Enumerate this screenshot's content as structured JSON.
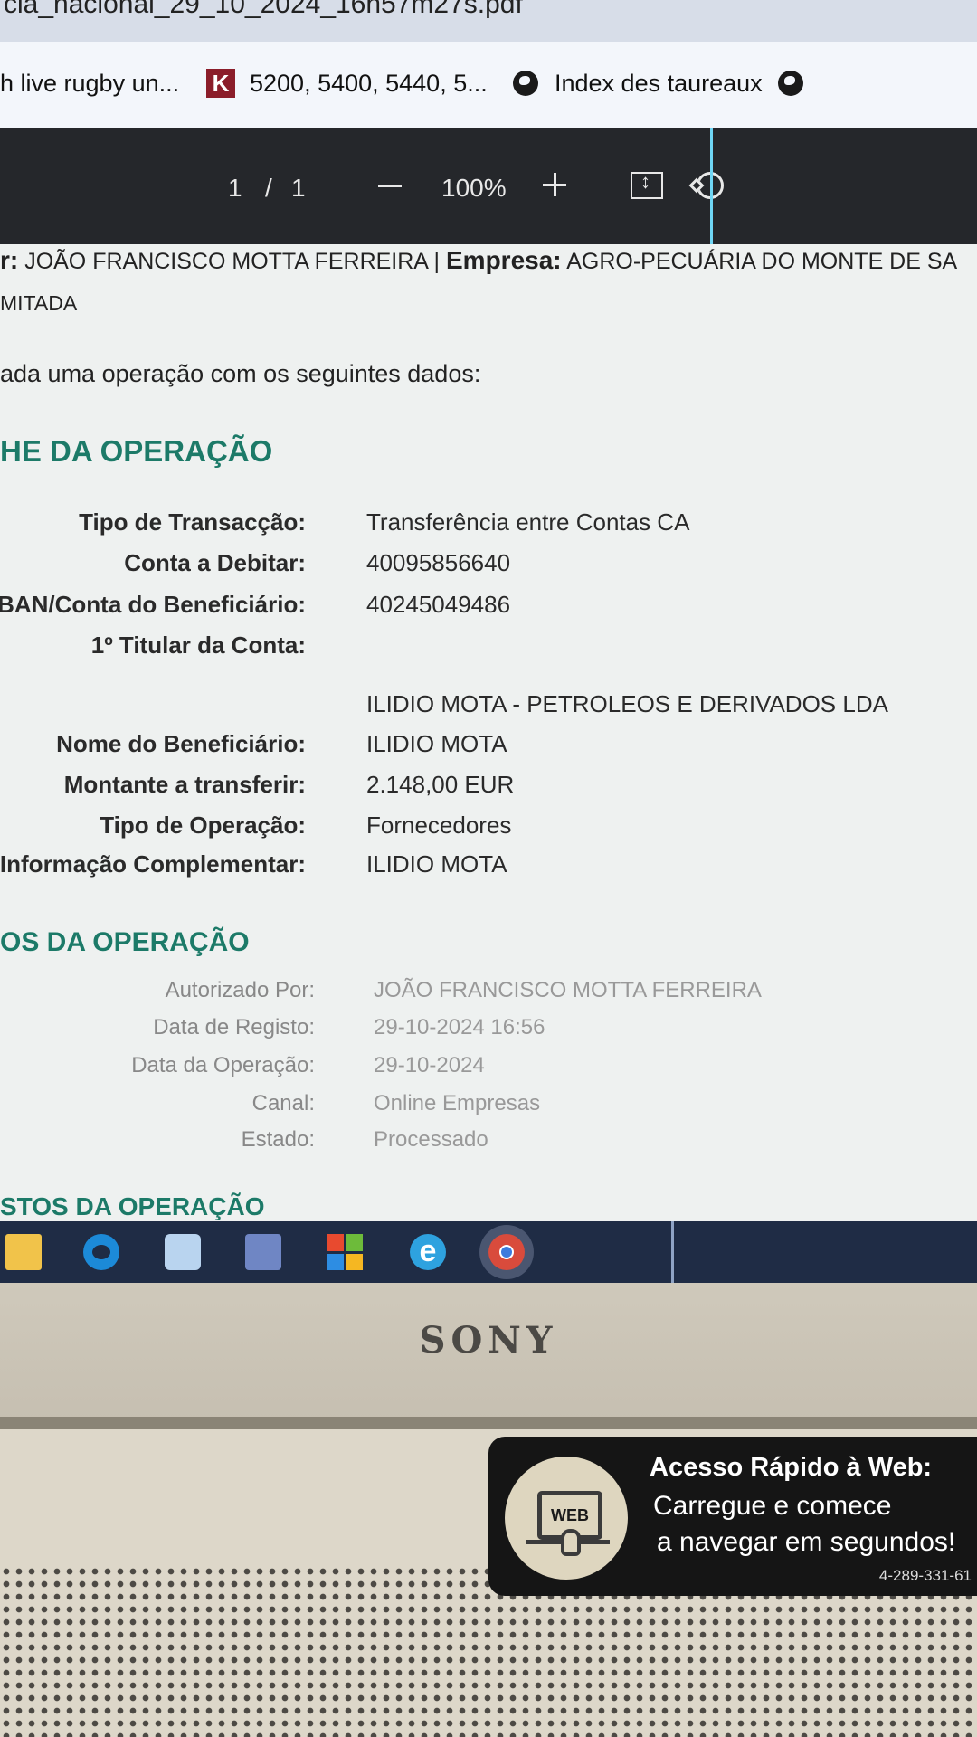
{
  "window": {
    "title_fragment": "cia_nacional_29_10_2024_16h57m27s.pdf"
  },
  "bookmarks": [
    {
      "label": "h live rugby un...",
      "icon": "none"
    },
    {
      "label": "5200, 5400, 5440, 5...",
      "icon": "k-icon"
    },
    {
      "label": "Index des taureaux",
      "icon": "globe-icon"
    },
    {
      "label": "",
      "icon": "globe-icon"
    }
  ],
  "pdf_toolbar": {
    "page_current": "1",
    "page_separator": "/",
    "page_total": "1",
    "zoom_out": "−",
    "zoom": "100%",
    "zoom_in": "+"
  },
  "document": {
    "header_label1": "r:",
    "header_value1": "JOÃO FRANCISCO MOTTA FERREIRA |",
    "header_label2": "Empresa:",
    "header_value2": "AGRO-PECUÁRIA DO MONTE DE SA",
    "header_line2": "MITADA",
    "intro": "ada uma operação com os seguintes dados:",
    "section1_title": "HE DA OPERAÇÃO",
    "details": [
      {
        "label": "Tipo de Transacção:",
        "value": "Transferência entre Contas CA"
      },
      {
        "label": "Conta a Debitar:",
        "value": "40095856640"
      },
      {
        "label": "BAN/Conta do Beneficiário:",
        "value": "40245049486"
      },
      {
        "label": "1º Titular da Conta:",
        "value": ""
      },
      {
        "label": "",
        "value": "ILIDIO MOTA - PETROLEOS E DERIVADOS LDA"
      },
      {
        "label": "Nome do Beneficiário:",
        "value": "ILIDIO MOTA"
      },
      {
        "label": "Montante a transferir:",
        "value": "2.148,00 EUR"
      },
      {
        "label": "Tipo de Operação:",
        "value": "Fornecedores"
      },
      {
        "label": "Informação Complementar:",
        "value": "ILIDIO MOTA"
      }
    ],
    "section2_title": "OS DA OPERAÇÃO",
    "status": [
      {
        "label": "Autorizado Por:",
        "value": "JOÃO FRANCISCO MOTTA FERREIRA"
      },
      {
        "label": "Data de Registo:",
        "value": "29-10-2024 16:56"
      },
      {
        "label": "Data da Operação:",
        "value": "29-10-2024"
      },
      {
        "label": "Canal:",
        "value": "Online Empresas"
      },
      {
        "label": "Estado:",
        "value": "Processado"
      }
    ],
    "section3_title": "STOS DA OPERAÇÃO"
  },
  "laptop": {
    "brand": "SONY"
  },
  "sticker": {
    "badge_text": "WEB",
    "title": "Acesso Rápido à Web:",
    "line1": "Carregue e comece",
    "line2": "a navegar em segundos!",
    "code": "4-289-331-61"
  },
  "colors": {
    "section_title": "#1c7a68",
    "pdf_toolbar_bg": "#25272b",
    "taskbar_bg": "#1f2c45"
  }
}
